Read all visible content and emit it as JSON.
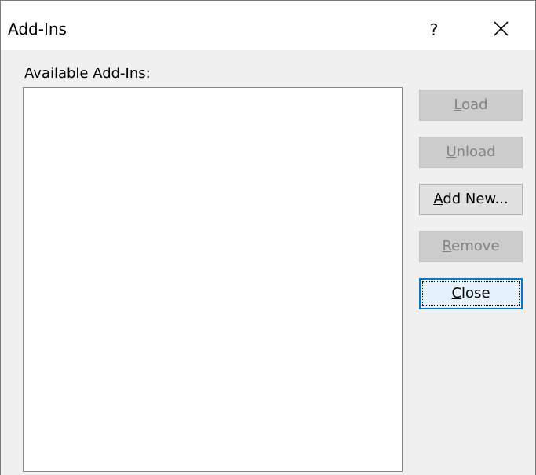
{
  "window": {
    "title": "Add-Ins",
    "help_label": "?"
  },
  "list": {
    "label_pre": "A",
    "label_ul": "v",
    "label_post": "ailable Add-Ins:",
    "items": []
  },
  "buttons": {
    "load": {
      "ul": "L",
      "rest": "oad"
    },
    "unload": {
      "ul": "U",
      "rest": "nload"
    },
    "add_new": {
      "ul": "A",
      "rest": "dd New..."
    },
    "remove": {
      "ul": "R",
      "rest": "emove"
    },
    "close": {
      "ul": "C",
      "rest": "lose"
    }
  },
  "colors": {
    "focus_border": "#0078d7",
    "disabled_text": "#838383"
  },
  "icons": {
    "close": "close-icon"
  }
}
